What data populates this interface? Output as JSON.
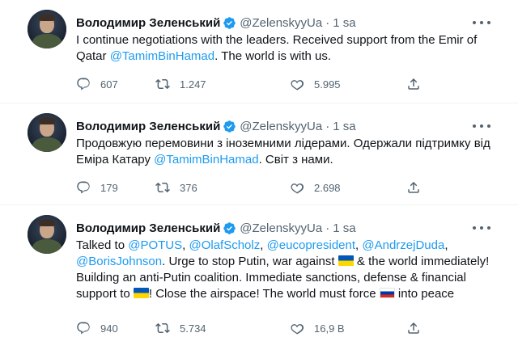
{
  "tweets": [
    {
      "author": "Володимир Зеленський",
      "handle": "@ZelenskyyUa",
      "separator": "·",
      "time": "1 sa",
      "text_before": "I continue negotiations with the leaders. Received support from the Emir of Qatar ",
      "mention": "@TamimBinHamad",
      "text_after": ". The world is with us.",
      "replies": "607",
      "retweets": "1.247",
      "likes": "5.995"
    },
    {
      "author": "Володимир Зеленський",
      "handle": "@ZelenskyyUa",
      "separator": "·",
      "time": "1 sa",
      "text_before": "Продовжую перемовини з іноземними лідерами. Одержали підтримку від Еміра Катару ",
      "mention": "@TamimBinHamad",
      "text_after": ". Світ з нами.",
      "replies": "179",
      "retweets": "376",
      "likes": "2.698"
    },
    {
      "author": "Володимир Зеленський",
      "handle": "@ZelenskyyUa",
      "separator": "·",
      "time": "1 sa",
      "text_start": "Talked to ",
      "mentions": [
        "@POTUS",
        "@OlafScholz",
        "@eucopresident",
        "@AndrzejDuda",
        "@BorisJohnson"
      ],
      "sep_comma": ", ",
      "text_mid1": ". Urge to stop Putin, war against ",
      "text_mid2": " & the world immediately! Building an anti-Putin coalition. Immediate sanctions, defense & financial support to ",
      "text_mid3": "! Close the airspace! The world must force ",
      "text_end": " into peace",
      "replies": "940",
      "retweets": "5.734",
      "likes": "16,9 B"
    }
  ],
  "icons": {
    "reply": "reply-icon",
    "retweet": "retweet-icon",
    "like": "heart-icon",
    "share": "share-icon",
    "verified": "verified-badge-icon",
    "more": "more-options-icon"
  },
  "colors": {
    "accent": "#1d9bf0",
    "text": "#0f1419",
    "secondary": "#536471"
  }
}
